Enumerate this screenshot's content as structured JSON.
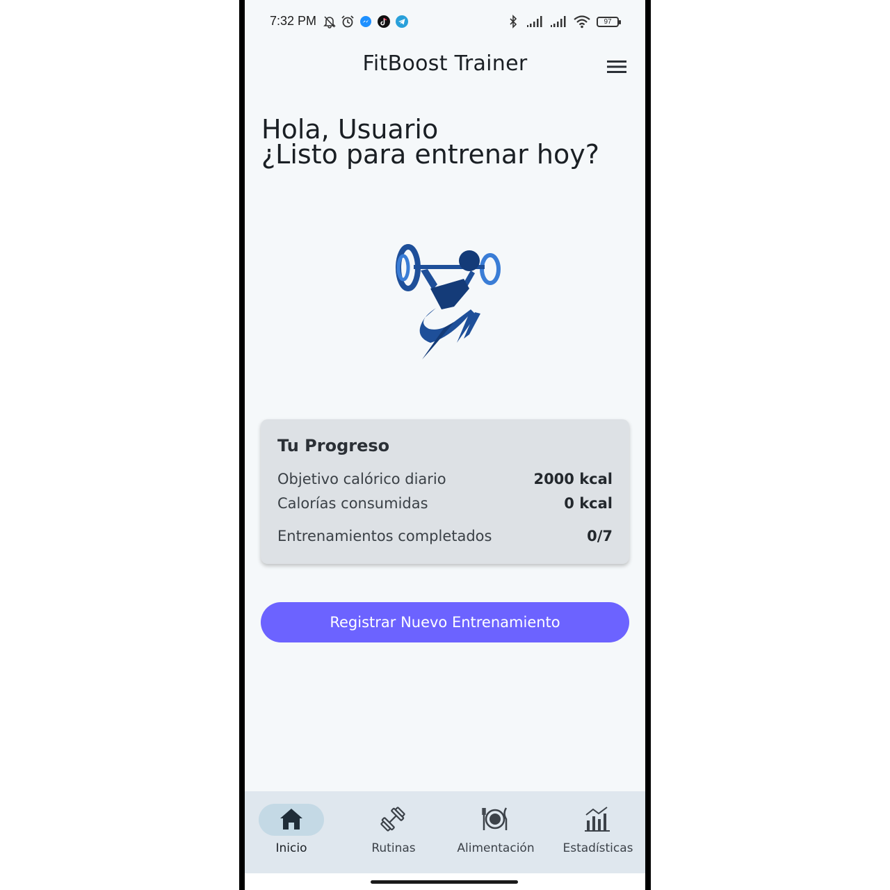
{
  "status_bar": {
    "time": "7:32 PM",
    "battery": "97",
    "left_icons": [
      "bell-off-icon",
      "alarm-icon",
      "messenger-icon",
      "tiktok-icon",
      "telegram-icon"
    ],
    "right_icons": [
      "bluetooth-icon",
      "signal-icon",
      "signal-icon",
      "wifi-icon",
      "battery-icon"
    ]
  },
  "app_bar": {
    "title": "FitBoost Trainer",
    "menu_icon": "hamburger-menu-icon"
  },
  "greeting": {
    "line1": "Hola, Usuario",
    "line2": "¿Listo para entrenar hoy?"
  },
  "logo": {
    "icon": "weightlifter-logo",
    "color": "#1e4f99"
  },
  "progress_card": {
    "title": "Tu Progreso",
    "rows": [
      {
        "label": "Objetivo calórico diario",
        "value": "2000 kcal"
      },
      {
        "label": "Calorías consumidas",
        "value": "0 kcal"
      },
      {
        "label": "Entrenamientos completados",
        "value": "0/7"
      }
    ]
  },
  "primary_button": {
    "label": "Registrar Nuevo Entrenamiento",
    "color": "#6c63ff"
  },
  "bottom_nav": {
    "items": [
      {
        "label": "Inicio",
        "icon": "home-icon",
        "active": true
      },
      {
        "label": "Rutinas",
        "icon": "dumbbell-icon",
        "active": false
      },
      {
        "label": "Alimentación",
        "icon": "plate-icon",
        "active": false
      },
      {
        "label": "Estadísticas",
        "icon": "stats-icon",
        "active": false
      }
    ]
  }
}
